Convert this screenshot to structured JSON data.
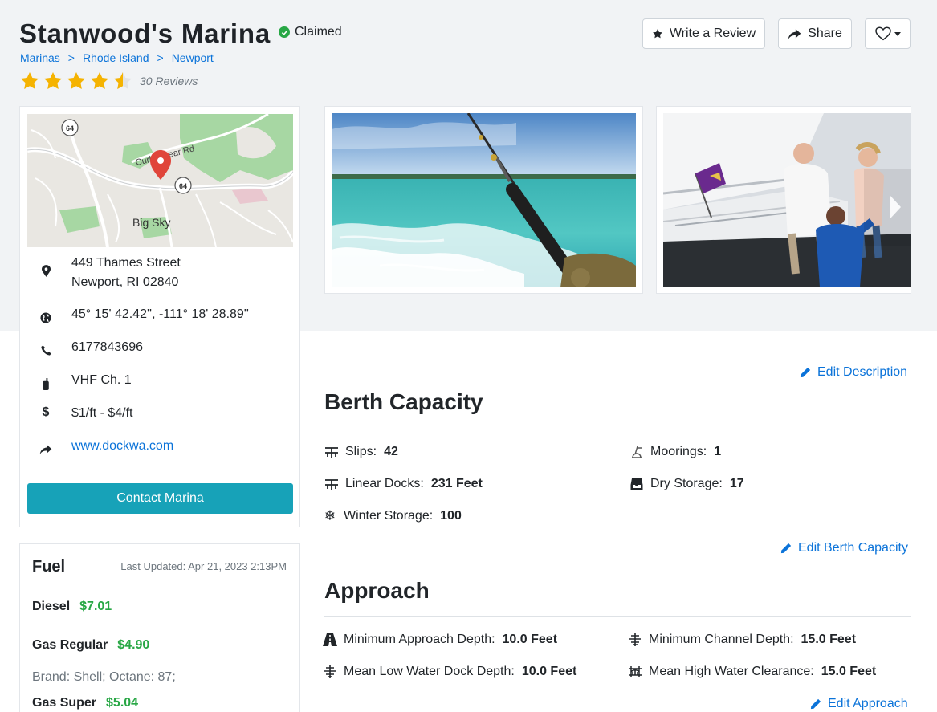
{
  "marina": {
    "name": "Stanwood's Marina",
    "claimed_label": "Claimed",
    "breadcrumb": [
      "Marinas",
      "Rhode Island",
      "Newport"
    ],
    "rating": 4.5,
    "reviews_label": "30 Reviews"
  },
  "actions": {
    "write_review": "Write a Review",
    "share": "Share"
  },
  "map": {
    "road_label": "Curley Bear Rd",
    "town_label": "Big Sky",
    "route_shield": "64"
  },
  "info": {
    "address_line1": "449 Thames Street",
    "address_line2": "Newport, RI 02840",
    "coordinates": "45° 15' 42.42'', -111° 18' 28.89''",
    "phone": "6177843696",
    "vhf": "VHF Ch. 1",
    "price": "$1/ft - $4/ft",
    "website": "www.dockwa.com",
    "contact_button": "Contact Marina"
  },
  "fuel": {
    "title": "Fuel",
    "last_updated": "Last Updated: Apr 21, 2023 2:13PM",
    "diesel_label": "Diesel",
    "diesel_price": "$7.01",
    "gas_regular_label": "Gas Regular",
    "gas_regular_price": "$4.90",
    "brand_info": "Brand: Shell; Octane: 87;",
    "gas_super_label": "Gas Super",
    "gas_super_price": "$5.04"
  },
  "berth": {
    "edit_description": "Edit Description",
    "title": "Berth Capacity",
    "slips_label": "Slips:",
    "slips_value": "42",
    "moorings_label": "Moorings:",
    "moorings_value": "1",
    "linear_docks_label": "Linear Docks:",
    "linear_docks_value": "231 Feet",
    "dry_storage_label": "Dry Storage:",
    "dry_storage_value": "17",
    "winter_storage_label": "Winter Storage:",
    "winter_storage_value": "100",
    "edit_label": "Edit Berth Capacity"
  },
  "approach": {
    "title": "Approach",
    "min_approach_label": "Minimum Approach Depth:",
    "min_approach_value": "10.0 Feet",
    "min_channel_label": "Minimum Channel Depth:",
    "min_channel_value": "15.0 Feet",
    "mean_low_label": "Mean Low Water Dock Depth:",
    "mean_low_value": "10.0 Feet",
    "mean_high_label": "Mean High Water Clearance:",
    "mean_high_value": "15.0 Feet",
    "edit_label": "Edit Approach"
  },
  "colors": {
    "accent_link": "#0b73d9",
    "contact_button": "#17a2b8",
    "price_green": "#28a745",
    "star_gold": "#f5b301",
    "band_grey": "#f1f3f5"
  }
}
